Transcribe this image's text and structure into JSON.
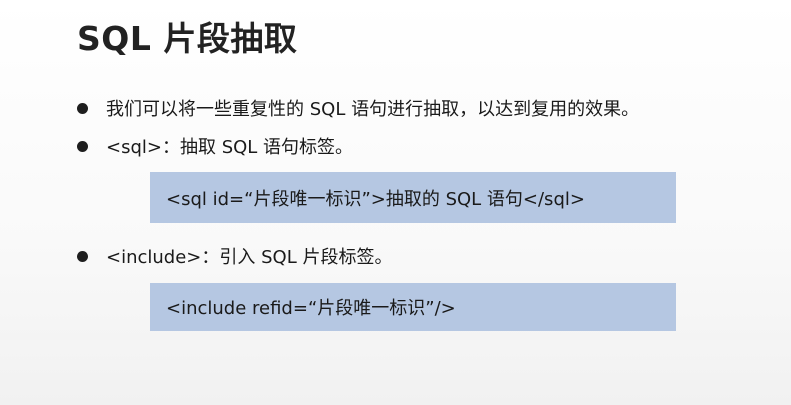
{
  "slide": {
    "title": "SQL 片段抽取"
  },
  "bullets": [
    {
      "text": "我们可以将一些重复性的 SQL 语句进行抽取，以达到复用的效果。"
    },
    {
      "text": "<sql>：抽取 SQL 语句标签。"
    },
    {
      "text": "<include>：引入 SQL 片段标签。"
    }
  ],
  "code_boxes": [
    {
      "code": "<sql id=“片段唯一标识”>抽取的 SQL 语句</sql>"
    },
    {
      "code": "<include refid=“片段唯一标识”/>"
    }
  ]
}
